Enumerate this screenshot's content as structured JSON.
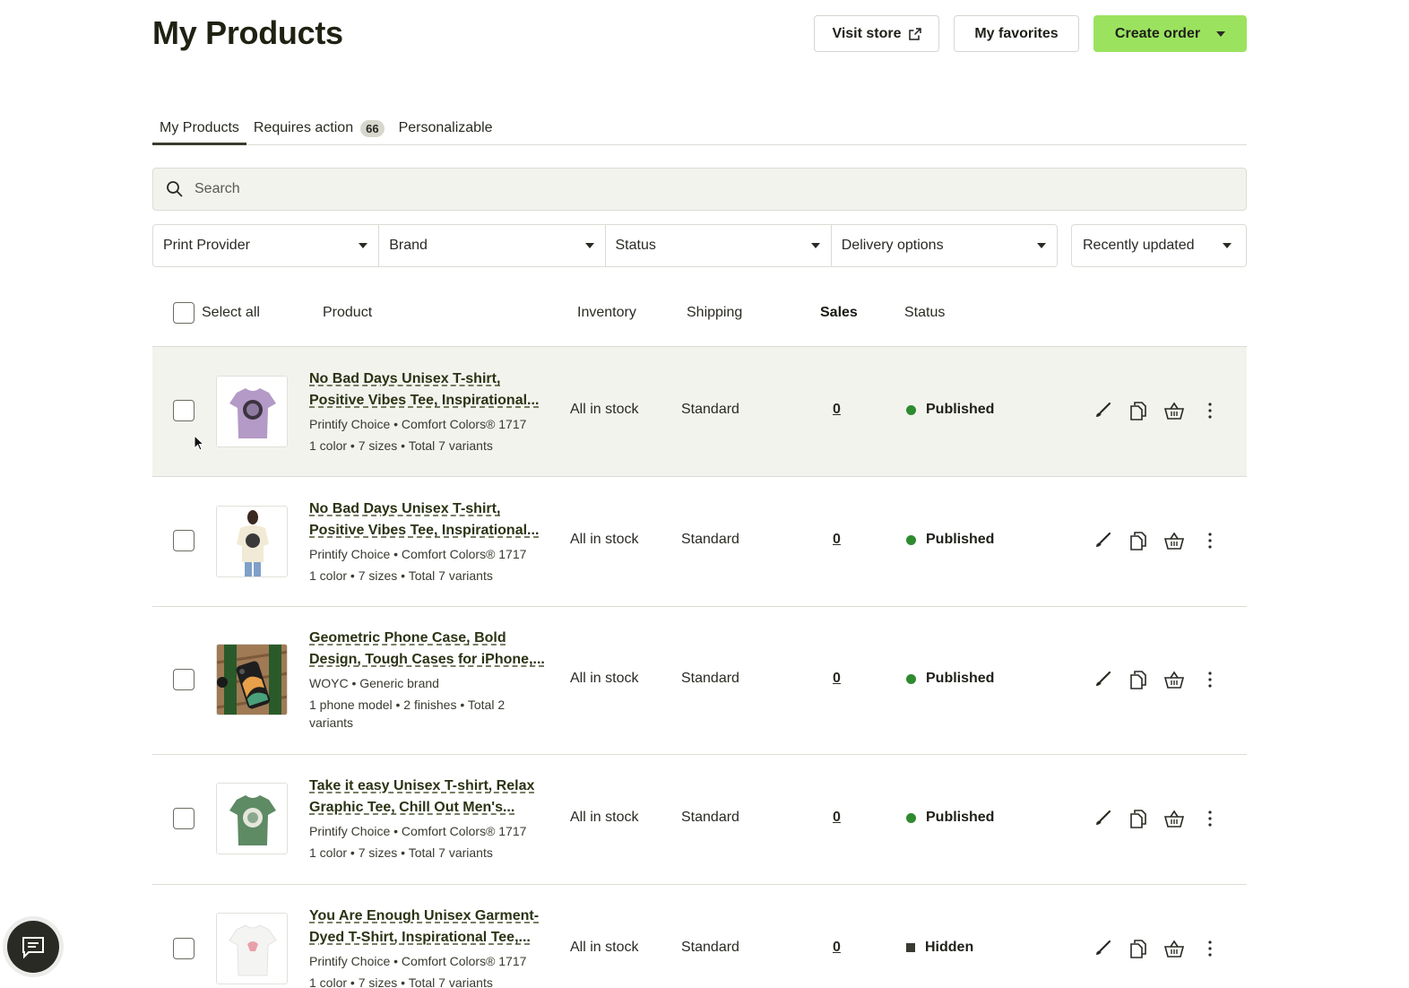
{
  "header": {
    "title": "My Products",
    "visit_store_label": "Visit store",
    "favorites_label": "My favorites",
    "create_order_label": "Create order"
  },
  "tabs": [
    {
      "label": "My Products",
      "active": true
    },
    {
      "label": "Requires action",
      "badge": "66"
    },
    {
      "label": "Personalizable"
    }
  ],
  "search": {
    "placeholder": "Search"
  },
  "filters": {
    "items": [
      "Print Provider",
      "Brand",
      "Status",
      "Delivery options"
    ],
    "sort": "Recently updated"
  },
  "table": {
    "select_all": "Select all",
    "columns": [
      "Product",
      "Inventory",
      "Shipping",
      "Sales",
      "Status"
    ]
  },
  "products": [
    {
      "title": "No Bad Days Unisex T-shirt, Positive Vibes Tee, Inspirational...",
      "provider": "Printify Choice • Comfort Colors® 1717",
      "variants": "1 color • 7 sizes • Total 7 variants",
      "inventory": "All in stock",
      "shipping": "Standard",
      "sales": "0",
      "status": "Published",
      "thumb": "purple-tshirt"
    },
    {
      "title": "No Bad Days Unisex T-shirt, Positive Vibes Tee, Inspirational...",
      "provider": "Printify Choice • Comfort Colors® 1717",
      "variants": "1 color • 7 sizes • Total 7 variants",
      "inventory": "All in stock",
      "shipping": "Standard",
      "sales": "0",
      "status": "Published",
      "thumb": "model-tshirt"
    },
    {
      "title": "Geometric Phone Case, Bold Design, Tough Cases for iPhone,...",
      "provider": "WOYC • Generic brand",
      "variants": "1 phone model • 2 finishes • Total 2 variants",
      "inventory": "All in stock",
      "shipping": "Standard",
      "sales": "0",
      "status": "Published",
      "thumb": "phone-case"
    },
    {
      "title": "Take it easy Unisex T-shirt, Relax Graphic Tee, Chill Out Men's...",
      "provider": "Printify Choice • Comfort Colors® 1717",
      "variants": "1 color • 7 sizes • Total 7 variants",
      "inventory": "All in stock",
      "shipping": "Standard",
      "sales": "0",
      "status": "Published",
      "thumb": "green-tshirt"
    },
    {
      "title": "You Are Enough Unisex Garment-Dyed T-Shirt, Inspirational Tee,...",
      "provider": "Printify Choice • Comfort Colors® 1717",
      "variants": "1 color • 7 sizes • Total 7 variants",
      "inventory": "All in stock",
      "shipping": "Standard",
      "sales": "0",
      "status": "Hidden",
      "thumb": "white-tshirt"
    }
  ],
  "colors": {
    "accent": "#9be35f",
    "published": "#2e8b2e",
    "hidden": "#3a3a32",
    "row_hover": "#f3f3ee"
  }
}
